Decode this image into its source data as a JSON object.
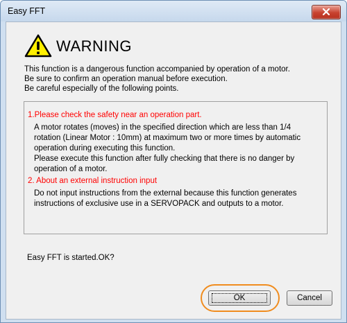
{
  "window": {
    "title": "Easy FFT"
  },
  "warning": {
    "heading": "WARNING",
    "intro_lines": [
      "This function is a dangerous function accompanied by operation of a motor.",
      "Be sure to confirm an operation manual before execution.",
      "Be careful especially of the following points."
    ]
  },
  "notice": {
    "point1_title": "1.Please check the safety near an operation part.",
    "point1_lines": [
      "A motor rotates (moves) in the specified direction which are less than 1/4",
      "rotation (Linear Motor : 10mm) at maximum two or more times by automatic",
      "operation during executing this function.",
      "Please execute this function after fully checking that there is no danger by",
      "operation of a motor."
    ],
    "point2_title": "2. About an external instruction input",
    "point2_lines": [
      "Do not input instructions from the external because this function generates",
      "instructions of exclusive use in a SERVOPACK and outputs to a motor."
    ]
  },
  "prompt": {
    "question": "Easy FFT is started.OK?"
  },
  "buttons": {
    "ok": "OK",
    "cancel": "Cancel"
  },
  "colors": {
    "warning_text": "#ff0000",
    "highlight_ring": "#f08c1e",
    "close_button": "#c8422f"
  },
  "icons": {
    "warning": "warning-triangle-icon",
    "close": "close-icon"
  }
}
